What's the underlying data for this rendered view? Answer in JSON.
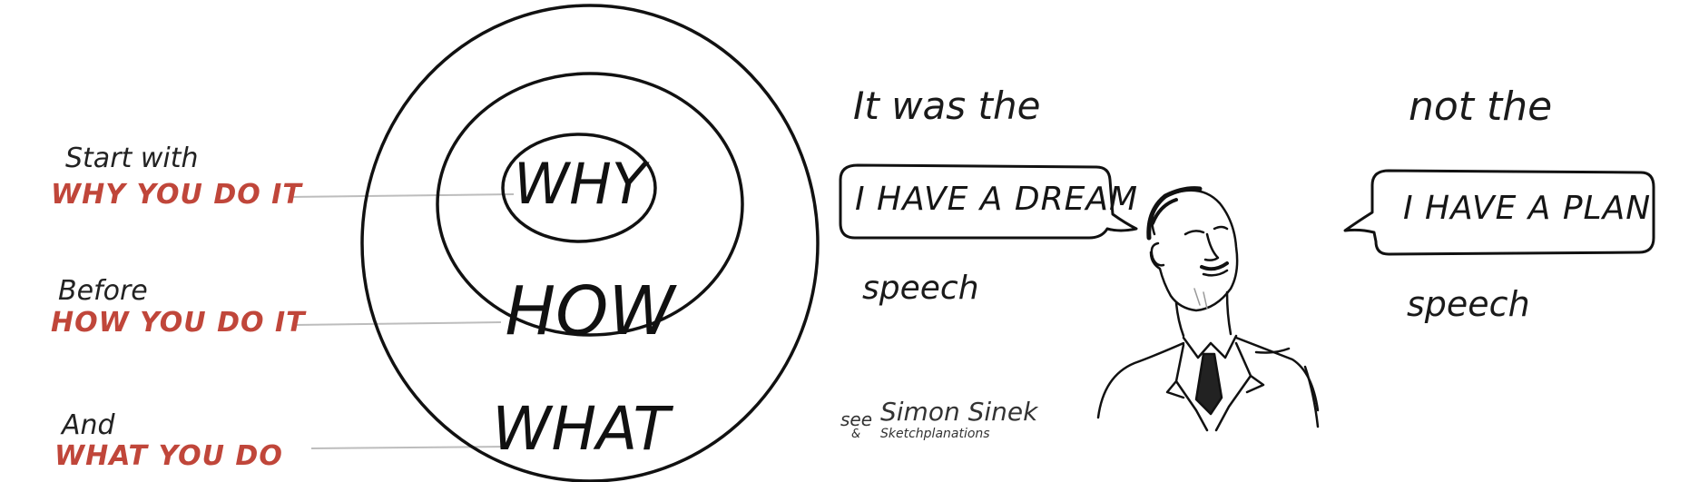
{
  "labels": {
    "why_lead": "Start  with",
    "why_red": "WHY YOU DO IT",
    "how_lead": "Before",
    "how_red": "HOW YOU DO IT",
    "what_lead": "And",
    "what_red": "WHAT YOU DO"
  },
  "circles": {
    "inner": "WHY",
    "middle": "HOW",
    "outer": "WHAT"
  },
  "speech": {
    "left_intro": "It was the",
    "left_bubble": "I HAVE A DREAM",
    "left_outro": "speech",
    "right_intro": "not the",
    "right_bubble": "I HAVE A PLAN",
    "right_outro": "speech"
  },
  "credit": {
    "see": "see",
    "name": "Simon Sinek",
    "amp": "&",
    "site": "Sketchplanations"
  },
  "colors": {
    "accent_red": "#c0463a",
    "ink": "#1a1a1a",
    "guide_line": "#bdbdbd"
  }
}
